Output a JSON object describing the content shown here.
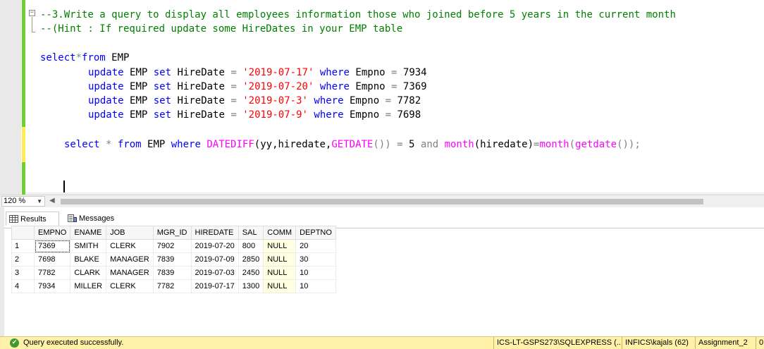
{
  "editor": {
    "comment_line1": "--3.Write a query to display all employees information those who joined before 5 years in the current month",
    "comment_line2": "--(Hint : If required update some HireDates in your EMP table",
    "select_line": {
      "kw1": "select",
      "op": "*",
      "kw2": "from",
      "table": " EMP"
    },
    "updates": [
      {
        "date": "'2019-07-17'",
        "empno": "7934"
      },
      {
        "date": "'2019-07-20'",
        "empno": "7369"
      },
      {
        "date": "'2019-07-3'",
        "empno": "7782"
      },
      {
        "date": "'2019-07-9'",
        "empno": "7698"
      }
    ],
    "query": {
      "select": "select",
      "star": " * ",
      "from": "from",
      "table": " EMP ",
      "where": "where",
      "datediff": "DATEDIFF",
      "args1": "(yy,hiredate,",
      "getdate": "GETDATE",
      "close1": "())",
      "eq": " = ",
      "five": "5",
      "and": " and ",
      "month1": "month",
      "args2": "(hiredate)",
      "eq2": "=",
      "month2": "month",
      "open": "(",
      "getdate2": "getdate",
      "close2": "());"
    },
    "kw_update": "update",
    "kw_set": "set",
    "kw_where": "where",
    "col_hiredate": "HireDate",
    "col_empno": "Empno",
    "tbl_emp": "EMP",
    "op_eq": "="
  },
  "zoom": {
    "value": "120 %"
  },
  "tabs": {
    "results": "Results",
    "messages": "Messages"
  },
  "grid": {
    "columns": [
      "EMPNO",
      "ENAME",
      "JOB",
      "MGR_ID",
      "HIREDATE",
      "SAL",
      "COMM",
      "DEPTNO"
    ],
    "rows": [
      {
        "n": "1",
        "cells": [
          "7369",
          "SMITH",
          "CLERK",
          "7902",
          "2019-07-20",
          "800",
          "NULL",
          "20"
        ]
      },
      {
        "n": "2",
        "cells": [
          "7698",
          "BLAKE",
          "MANAGER",
          "7839",
          "2019-07-09",
          "2850",
          "NULL",
          "30"
        ]
      },
      {
        "n": "3",
        "cells": [
          "7782",
          "CLARK",
          "MANAGER",
          "7839",
          "2019-07-03",
          "2450",
          "NULL",
          "10"
        ]
      },
      {
        "n": "4",
        "cells": [
          "7934",
          "MILLER",
          "CLERK",
          "7782",
          "2019-07-17",
          "1300",
          "NULL",
          "10"
        ]
      }
    ]
  },
  "status": {
    "message": "Query executed successfully.",
    "server": "ICS-LT-GSPS273\\SQLEXPRESS (...",
    "user": "INFICS\\kajals (62)",
    "database": "Assignment_2",
    "extra": "0"
  },
  "colors": {
    "keyword": "#0000ff",
    "string": "#ff0000",
    "function": "#ff00ff",
    "comment": "#008000",
    "status_bar": "#fff2a8",
    "null_cell": "#ffffe1"
  }
}
